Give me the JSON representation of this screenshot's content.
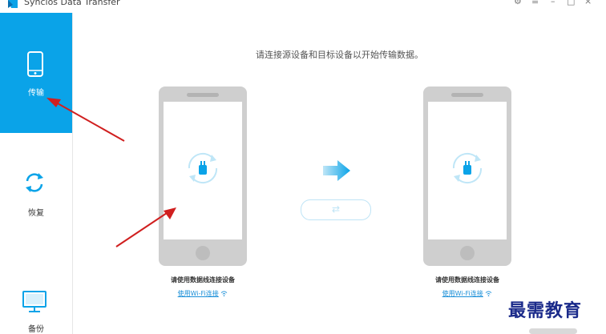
{
  "window": {
    "title": "Syncios Data Transfer",
    "controls": {
      "settings": "⚙",
      "menu": "≡",
      "minimize": "–",
      "maximize": "□",
      "close": "×"
    }
  },
  "colors": {
    "accent": "#0aa3e8",
    "phone_body": "#cfcfcf",
    "annotation_arrow": "#d01f1f",
    "link": "#1a8fd8"
  },
  "sidebar": {
    "items": [
      {
        "label": "传输",
        "icon": "phone-icon",
        "active": true
      },
      {
        "label": "恢复",
        "icon": "refresh-icon",
        "active": false
      },
      {
        "label": "备份",
        "icon": "monitor-icon",
        "active": false
      }
    ]
  },
  "main": {
    "instruction": "请连接源设备和目标设备以开始传输数据。",
    "source_phone": {
      "caption": "请使用数据线连接设备",
      "wifi_link": "使用Wi-Fi连接"
    },
    "target_phone": {
      "caption": "请使用数据线连接设备",
      "wifi_link": "使用Wi-Fi连接"
    },
    "swap_icon": "⇄"
  },
  "watermark": "最需教育"
}
